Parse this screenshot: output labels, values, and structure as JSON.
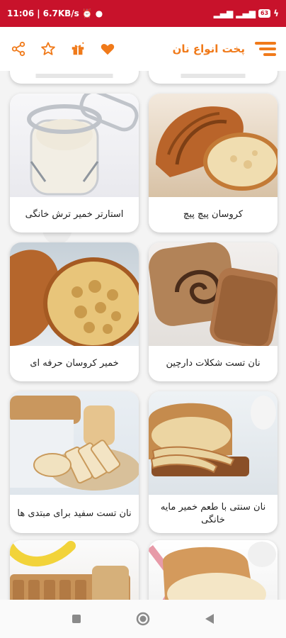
{
  "status_bar": {
    "time": "11:06",
    "speed": "6.7KB/s",
    "battery": "63"
  },
  "app_bar": {
    "title": "پخت انواع نان",
    "icons": [
      "share-icon",
      "star-icon",
      "gift-icon",
      "heart-icon",
      "menu-icon"
    ]
  },
  "cards": [
    {
      "label": "استارتر خمیر ترش خانگی",
      "image": "sourdough-starter-jar"
    },
    {
      "label": "کروسان پیچ پیچ",
      "image": "croissant"
    },
    {
      "label": "خمیر کروسان حرفه ای",
      "image": "croissant-crumb"
    },
    {
      "label": "نان تست شکلات دارچین",
      "image": "cinnamon-chocolate-bread"
    },
    {
      "label": "نان تست سفید برای مبتدی ها",
      "image": "white-toast-bread"
    },
    {
      "label": "نان سنتی با طعم خمیر مایه خانگی",
      "image": "sliced-traditional-bread"
    },
    {
      "label": "",
      "image": "banana-bread"
    },
    {
      "label": "",
      "image": "white-loaf"
    }
  ],
  "colors": {
    "status_bar": "#c8122b",
    "accent": "#f07a1a",
    "background": "#f4f4f4"
  }
}
